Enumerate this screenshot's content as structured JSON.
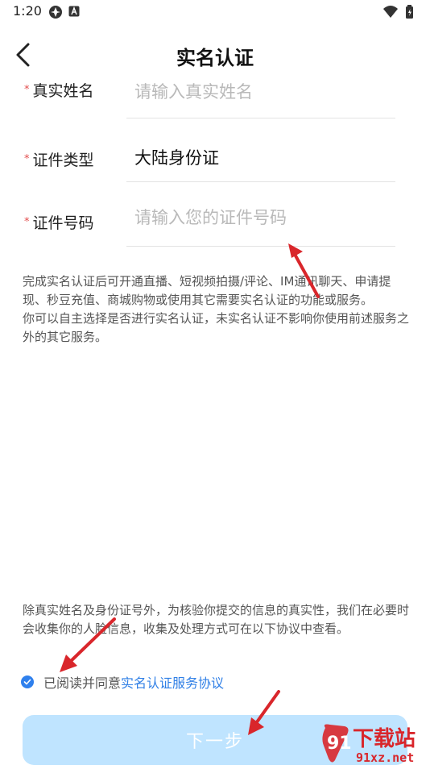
{
  "status_bar": {
    "time": "1:20",
    "battery_level": 0.9
  },
  "header": {
    "title": "实名认证",
    "back_icon": "chevron-left-icon"
  },
  "form": {
    "name": {
      "label": "真实姓名",
      "placeholder": "请输入真实姓名",
      "value": ""
    },
    "id_type": {
      "label": "证件类型",
      "value": "大陆身份证"
    },
    "id_number": {
      "label": "证件号码",
      "placeholder": "请输入您的证件号码",
      "value": ""
    },
    "required_mark": "*"
  },
  "notice": {
    "text": "完成实名认证后可开通直播、短视频拍摄/评论、IM通讯聊天、申请提现、秒豆充值、商城购物或使用其它需要实名认证的功能或服务。\n你可以自主选择是否进行实名认证，未实名认证不影响你使用前述服务之外的其它服务。"
  },
  "face_notice": {
    "text": "除真实姓名及身份证号外，为核验你提交的信息的真实性，我们在必要时会收集你的人脸信息，收集及处理方式可在以下协议中查看。"
  },
  "agreement": {
    "checked": true,
    "prefix": "已阅读并同意",
    "link": "实名认证服务协议"
  },
  "next_button": {
    "label": "下一步"
  },
  "watermark": {
    "brand": "下载站",
    "domain": "91xz.net"
  },
  "colors": {
    "accent": "#2f80ed",
    "button_bg": "#bfe4ff",
    "required": "#e34d4d",
    "arrow": "#d9262b"
  }
}
